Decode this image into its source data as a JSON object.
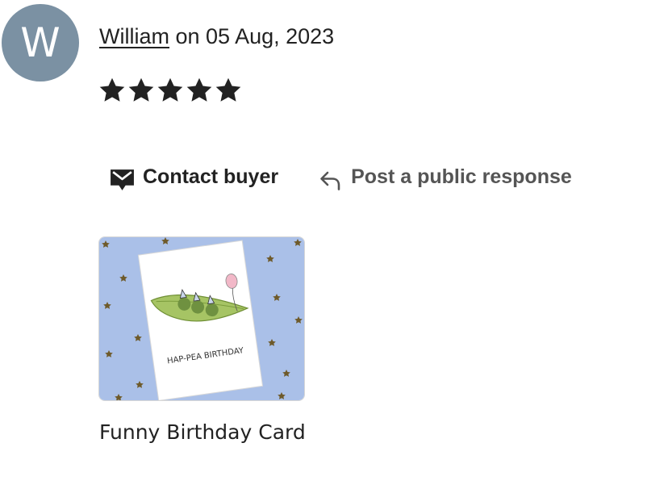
{
  "review": {
    "avatar_initial": "W",
    "reviewer_name": "William",
    "date_text": " on 05 Aug, 2023",
    "rating": 5,
    "rating_max": 5
  },
  "actions": {
    "contact_label": "Contact buyer",
    "respond_label": "Post a public response"
  },
  "product": {
    "card_text": "HAP-PEA BIRTHDAY",
    "caption": "Funny Birthday Card"
  },
  "icons": {
    "contact": "envelope-message-icon",
    "respond": "reply-arrow-icon",
    "star": "star-icon"
  },
  "colors": {
    "avatar_bg": "#7b91a3",
    "star": "#222222",
    "thumb_bg": "#aac0e8"
  }
}
